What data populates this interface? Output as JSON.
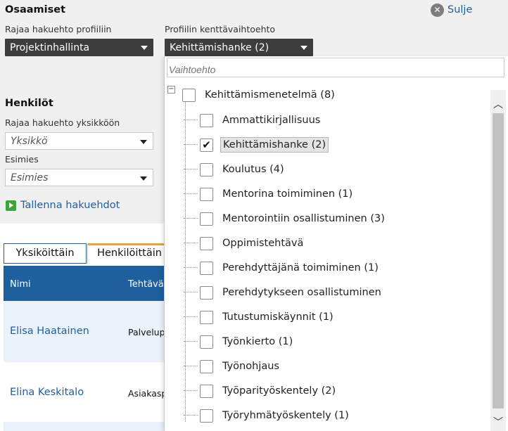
{
  "competences": {
    "title": "Osaamiset",
    "filter_label": "Rajaa hakuehto profiiliin",
    "profile_select_value": "Projektinhallinta",
    "field_option_label": "Profiilin kenttävaihtoehto",
    "field_option_value": "Kehittämishanke (2)",
    "close_label": "Sulje"
  },
  "persons": {
    "title": "Henkilöt",
    "unit_label": "Rajaa hakuehto yksikköön",
    "unit_placeholder": "Yksikkö",
    "manager_label": "Esimies",
    "manager_placeholder": "Esimies",
    "save_label": "Tallenna hakuehdot"
  },
  "tabs": [
    {
      "label": "Yksiköittäin"
    },
    {
      "label": "Henkilöittäin"
    }
  ],
  "table": {
    "headers": [
      "Nimi",
      "Tehtävär"
    ],
    "rows": [
      {
        "name": "Elisa Haatainen",
        "job": "Palvelup"
      },
      {
        "name": "Elina Keskitalo",
        "job": "Asiakasp"
      }
    ]
  },
  "dropdown": {
    "search_placeholder": "Vaihtoehto",
    "parent": {
      "label": "Kehittämismenetelmä (8)",
      "checked": false
    },
    "options": [
      {
        "label": "Ammattikirjallisuus",
        "checked": false
      },
      {
        "label": "Kehittämishanke (2)",
        "checked": true
      },
      {
        "label": "Koulutus (4)",
        "checked": false
      },
      {
        "label": "Mentorina toimiminen (1)",
        "checked": false
      },
      {
        "label": "Mentorointiin osallistuminen (3)",
        "checked": false
      },
      {
        "label": "Oppimistehtävä",
        "checked": false
      },
      {
        "label": "Perehdyttäjänä toimiminen (1)",
        "checked": false
      },
      {
        "label": "Perehdytykseen osallistuminen",
        "checked": false
      },
      {
        "label": "Tutustumiskäynnit (1)",
        "checked": false
      },
      {
        "label": "Työnkierto (1)",
        "checked": false
      },
      {
        "label": "Työnohjaus",
        "checked": false
      },
      {
        "label": "Työparityöskentely (2)",
        "checked": false
      },
      {
        "label": "Työryhmätyöskentely (1)",
        "checked": false
      }
    ]
  },
  "colors": {
    "header_blue": "#1e5f9e",
    "link_blue": "#1f5e9f",
    "tab_accent": "#e8a33c",
    "select_dark": "#3d3d3d",
    "save_green": "#3fa33b"
  },
  "icons": {
    "close": "close-circle-icon",
    "save": "play-icon",
    "collapse": "minus-box-icon",
    "check": "checkmark-icon",
    "select_arrow": "chevron-down-icon"
  }
}
